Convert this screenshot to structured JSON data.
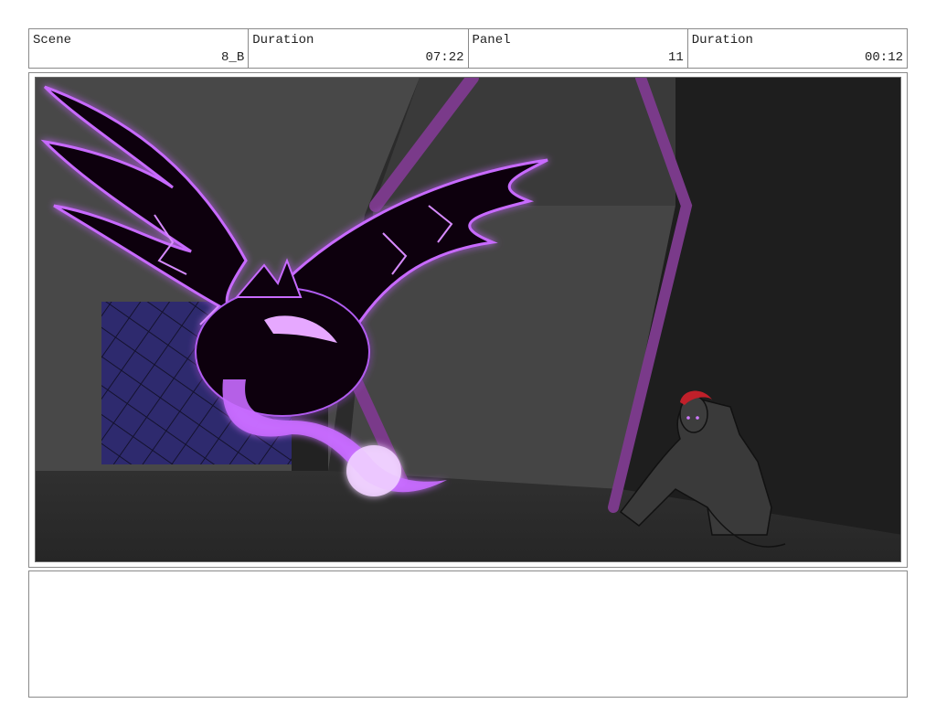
{
  "header": {
    "scene_label": "Scene",
    "scene_value": "8_B",
    "duration_label": "Duration",
    "duration_value": "07:22",
    "panel_label": "Panel",
    "panel_value": "11",
    "panel_duration_label": "Duration",
    "panel_duration_value": "00:12"
  },
  "panel_image": {
    "subject": "storyboard-drawing",
    "colors": {
      "background": "#2b2b2b",
      "wall_left": "#4a4a4a",
      "wall_center": "#3c3c3c",
      "wall_right": "#1f1f1f",
      "floor": "#2a2a2a",
      "door_blue": "#2e2a6e",
      "beam_purple": "#7a3a8a",
      "creature_glow": "#c86bff",
      "creature_body": "#0a0510",
      "hair_red": "#c0202a"
    }
  },
  "notes": {
    "text": ""
  }
}
